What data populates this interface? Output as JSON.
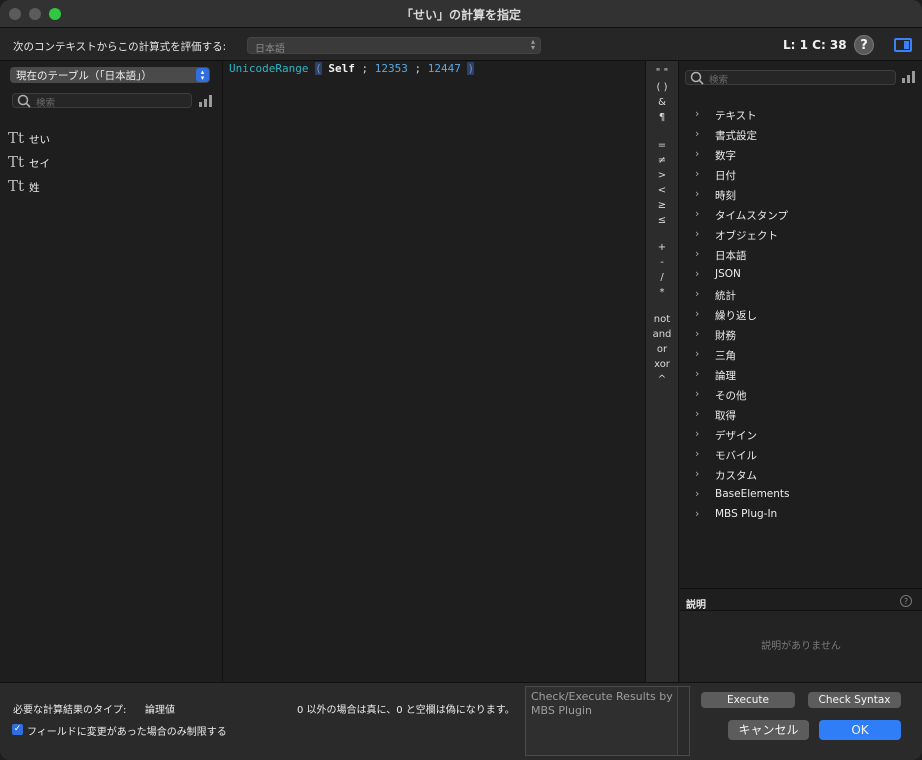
{
  "window": {
    "title": "「せい」の計算を指定"
  },
  "context": {
    "label": "次のコンテキストからこの計算式を評価する:",
    "selected": "日本語",
    "cursor_position": "L: 1 C: 38",
    "help_label": "?"
  },
  "left_panel": {
    "table_select": "現在のテーブル（「日本語」）",
    "search_placeholder": "検索",
    "fields": [
      {
        "type_icon": "Tt",
        "name": "せい"
      },
      {
        "type_icon": "Tt",
        "name": "セイ"
      },
      {
        "type_icon": "Tt",
        "name": "姓"
      }
    ]
  },
  "editor": {
    "function": "UnicodeRange",
    "open_paren": "(",
    "field": "Self",
    "sep1": ";",
    "arg1": "12353",
    "sep2": ";",
    "arg2": "12447",
    "close_paren": ")"
  },
  "operators": {
    "quotes": "\" \"",
    "parens": "( )",
    "amp": "&",
    "pilcrow": "¶",
    "eq": "=",
    "neq": "≠",
    "gt": ">",
    "lt": "<",
    "gte": "≥",
    "lte": "≤",
    "plus": "+",
    "minus": "-",
    "div": "/",
    "mul": "*",
    "not": "not",
    "and": "and",
    "or": "or",
    "xor": "xor",
    "pow": "^"
  },
  "right_panel": {
    "search_placeholder": "検索",
    "categories": [
      "テキスト",
      "書式設定",
      "数字",
      "日付",
      "時刻",
      "タイムスタンプ",
      "オブジェクト",
      "日本語",
      "JSON",
      "統計",
      "繰り返し",
      "財務",
      "三角",
      "論理",
      "その他",
      "取得",
      "デザイン",
      "モバイル",
      "カスタム",
      "BaseElements",
      "MBS Plug-In"
    ],
    "description_title": "説明",
    "description_empty": "説明がありません"
  },
  "footer": {
    "result_type_label": "必要な計算結果のタイプ:",
    "result_type_value": "論理値",
    "result_note": "0 以外の場合は真に、0 と空欄は偽になります。",
    "checkbox_label": "フィールドに変更があった場合のみ制限する",
    "checkbox_checked": true,
    "results_text": "Check/Execute Results by MBS Plugin",
    "execute_label": "Execute",
    "check_syntax_label": "Check Syntax",
    "cancel_label": "キャンセル",
    "ok_label": "OK"
  },
  "colors": {
    "accent": "#2f7ef7",
    "function_token": "#2fb5c4",
    "number_token": "#5aa9e6",
    "maximize": "#2fc840"
  }
}
